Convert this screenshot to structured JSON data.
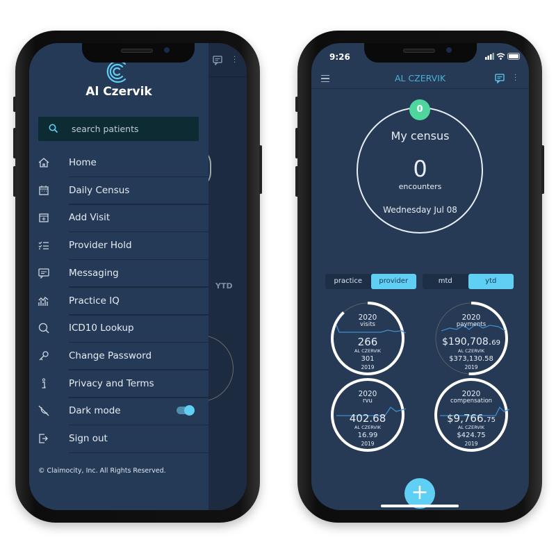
{
  "colors": {
    "accent": "#5fcff3",
    "badge": "#4fd69c",
    "background": "#263a55",
    "search_bg": "#0c2b33"
  },
  "drawer": {
    "user_name": "Al Czervik",
    "search_placeholder": "search patients",
    "items": [
      {
        "label": "Home",
        "icon": "home-icon"
      },
      {
        "label": "Daily Census",
        "icon": "calendar-icon"
      },
      {
        "label": "Add Visit",
        "icon": "calendar-plus-icon"
      },
      {
        "label": "Provider Hold",
        "icon": "checklist-icon"
      },
      {
        "label": "Messaging",
        "icon": "message-icon"
      },
      {
        "label": "Practice IQ",
        "icon": "chart-icon"
      },
      {
        "label": "ICD10 Lookup",
        "icon": "search-icon"
      },
      {
        "label": "Change Password",
        "icon": "key-icon"
      },
      {
        "label": "Privacy and Terms",
        "icon": "info-icon"
      },
      {
        "label": "Dark mode",
        "icon": "dark-mode-icon",
        "toggle": true
      },
      {
        "label": "Sign out",
        "icon": "sign-out-icon"
      }
    ],
    "dark_mode_on": true,
    "footer": "© Claimocity, Inc. All Rights Reserved.",
    "behind_label": "YTD"
  },
  "home": {
    "time": "9:26",
    "title": "AL CZERVIK",
    "census": {
      "badge": "0",
      "title": "My census",
      "count": "0",
      "unit": "encounters",
      "date": "Wednesday Jul 08"
    },
    "scope_toggle": {
      "options": [
        "practice",
        "provider"
      ],
      "selected": "provider"
    },
    "period_toggle": {
      "options": [
        "mtd",
        "ytd"
      ],
      "selected": "ytd"
    },
    "stats": [
      {
        "year": "2020",
        "metric": "visits",
        "value": "266",
        "cents": "",
        "who": "AL CZERVIK",
        "prior": "301",
        "prior_year": "2019",
        "progress": 0.88
      },
      {
        "year": "2020",
        "metric": "payments",
        "value": "$190,708.",
        "cents": "69",
        "who": "AL CZERVIK",
        "prior": "$373,130.58",
        "prior_year": "2019",
        "progress": 0.51
      },
      {
        "year": "2020",
        "metric": "rvu",
        "value": "402.68",
        "cents": "",
        "who": "AL CZERVIK",
        "prior": "16.99",
        "prior_year": "2019",
        "progress": 1
      },
      {
        "year": "2020",
        "metric": "compensation",
        "value": "$9,766.",
        "cents": "75",
        "who": "AL CZERVIK",
        "prior": "$424.75",
        "prior_year": "2019",
        "progress": 1
      }
    ],
    "fab": "+"
  }
}
